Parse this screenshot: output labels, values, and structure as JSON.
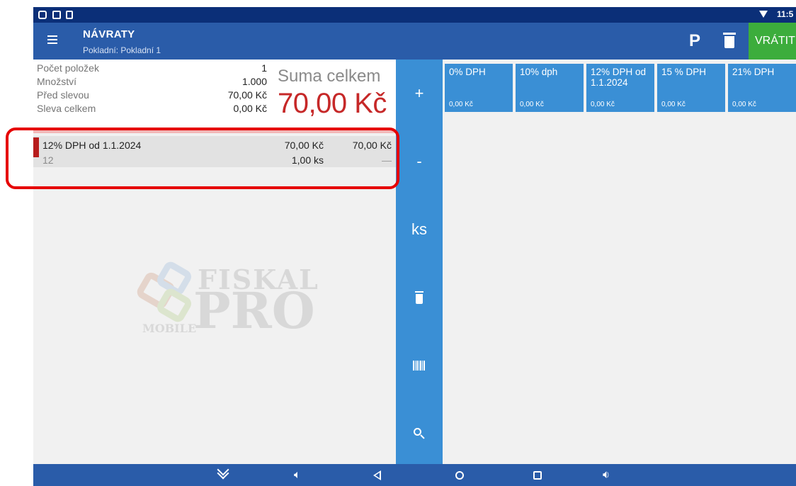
{
  "status_bar": {
    "time": "11:5",
    "icons": [
      "teamviewer-icon",
      "screenshot-icon",
      "sim-icon",
      "wifi-icon"
    ]
  },
  "app_bar": {
    "title": "NÁVRATY",
    "subtitle": "Pokladní: Pokladní 1",
    "p_label": "P",
    "return_label": "VRÁTIT",
    "icons": [
      "menu-icon",
      "trash-icon"
    ]
  },
  "summary": {
    "rows": [
      {
        "label": "Počet položek",
        "value": "1"
      },
      {
        "label": "Množství",
        "value": "1.000"
      },
      {
        "label": "Před slevou",
        "value": "70,00 Kč"
      },
      {
        "label": "Sleva celkem",
        "value": "0,00 Kč"
      }
    ],
    "total_label": "Suma celkem",
    "total_amount": "70,00 Kč"
  },
  "items": [
    {
      "name": "12% DPH od 1.1.2024",
      "code": "12",
      "unit_price": "70,00 Kč",
      "quantity": "1,00 ks",
      "total": "70,00 Kč",
      "discount": "—"
    }
  ],
  "keypad": {
    "plus": "+",
    "minus": "-",
    "unit": "ks",
    "icons": [
      "trash-icon",
      "barcode-icon",
      "search-icon"
    ]
  },
  "vat_tiles": [
    {
      "name": "0% DPH",
      "amount": "0,00 Kč"
    },
    {
      "name": "10% dph",
      "amount": "0,00 Kč"
    },
    {
      "name": "12% DPH od 1.1.2024",
      "amount": "0,00 Kč"
    },
    {
      "name": "15 % DPH",
      "amount": "0,00 Kč"
    },
    {
      "name": "21% DPH",
      "amount": "0,00 Kč"
    }
  ],
  "watermark": {
    "line1": "FISKAL",
    "line2": "PRO",
    "line3": "MOBILE"
  },
  "nav_bar": {
    "icons": [
      "hide-keyboard-icon",
      "volume-down-icon",
      "back-icon",
      "home-icon",
      "recents-icon",
      "volume-up-icon"
    ]
  },
  "colors": {
    "status_bar": "#0b2f78",
    "app_bar": "#2a5ca9",
    "accent_blue": "#3a8fd5",
    "return_green": "#3cad3c",
    "total_red": "#c62828",
    "highlight_red": "#e60000"
  }
}
